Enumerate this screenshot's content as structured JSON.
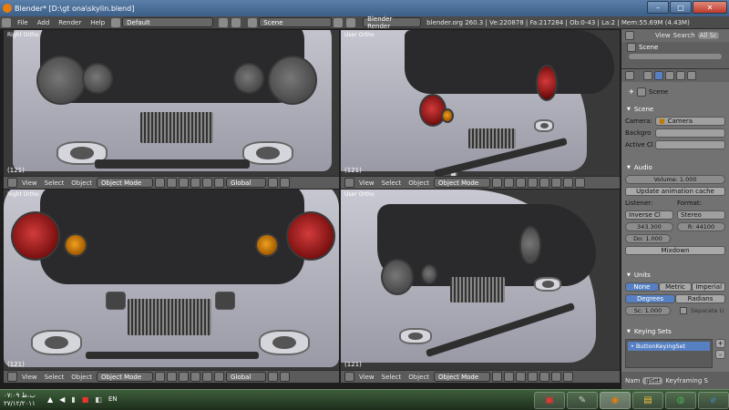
{
  "window": {
    "title": "Blender* [D:\\gt ona\\skylin.blend]",
    "minimize": "–",
    "maximize": "□",
    "close": "✕"
  },
  "info_header": {
    "menu": [
      "File",
      "Add",
      "Render",
      "Help"
    ],
    "layout": "Default",
    "scene": "Scene",
    "engine": "Blender Render",
    "stats": "blender.org 260.3 | Ve:220878 | Fa:217284 | Ob:0-43 | La:2 | Mem:55.69M (4.43M)"
  },
  "viewports": [
    {
      "label": "Right Ortho",
      "frame": "(121)"
    },
    {
      "label": "User Ortho",
      "frame": "(121)"
    },
    {
      "label": "Right Ortho",
      "frame": "(121)"
    },
    {
      "label": "User Ortho",
      "frame": "(121)"
    }
  ],
  "viewport_toolbar": {
    "view": "View",
    "select": "Select",
    "object": "Object",
    "mode": "Object Mode",
    "orientation": "Global"
  },
  "outliner": {
    "view": "View",
    "search": "Search",
    "filter": "All Sc",
    "scene_item": "Scene"
  },
  "properties": {
    "breadcrumb": "Scene",
    "scene_panel": {
      "title": "Scene",
      "camera_label": "Camera:",
      "camera_value": "Camera",
      "background_label": "Backgro",
      "active_label": "Active Cl"
    },
    "audio_panel": {
      "title": "Audio",
      "volume": "Volume: 1.000",
      "update_cache": "Update animation cache",
      "listener_label": "Listener:",
      "format_label": "Format:",
      "distance_model": "Inverse Cl",
      "format_value": "Stereo",
      "speed": "343.300",
      "rate": "R: 44100",
      "doppler": "Do: 1.000",
      "mixdown": "Mixdown"
    },
    "units_panel": {
      "title": "Units",
      "systems": [
        "None",
        "Metric",
        "Imperial"
      ],
      "rotation": [
        "Degrees",
        "Radians"
      ],
      "scale": "Sc: 1.000",
      "separate": "Separate U"
    },
    "keying_panel": {
      "title": "Keying Sets",
      "active_set": "ButtonKeyingSet",
      "add": "+",
      "remove": "–"
    },
    "footer": {
      "name_label": "Nam",
      "name_value": "gSet",
      "keyframing": "Keyframing S"
    }
  },
  "taskbar": {
    "time": "۰۷:۰۹ ب.ظ",
    "date": "۲۷/۱۲/۲۰۱۱",
    "language": "EN"
  },
  "colors": {
    "accent": "#5680c2",
    "viewport_bg": "#393939",
    "header_bg": "#4b4b4b"
  }
}
